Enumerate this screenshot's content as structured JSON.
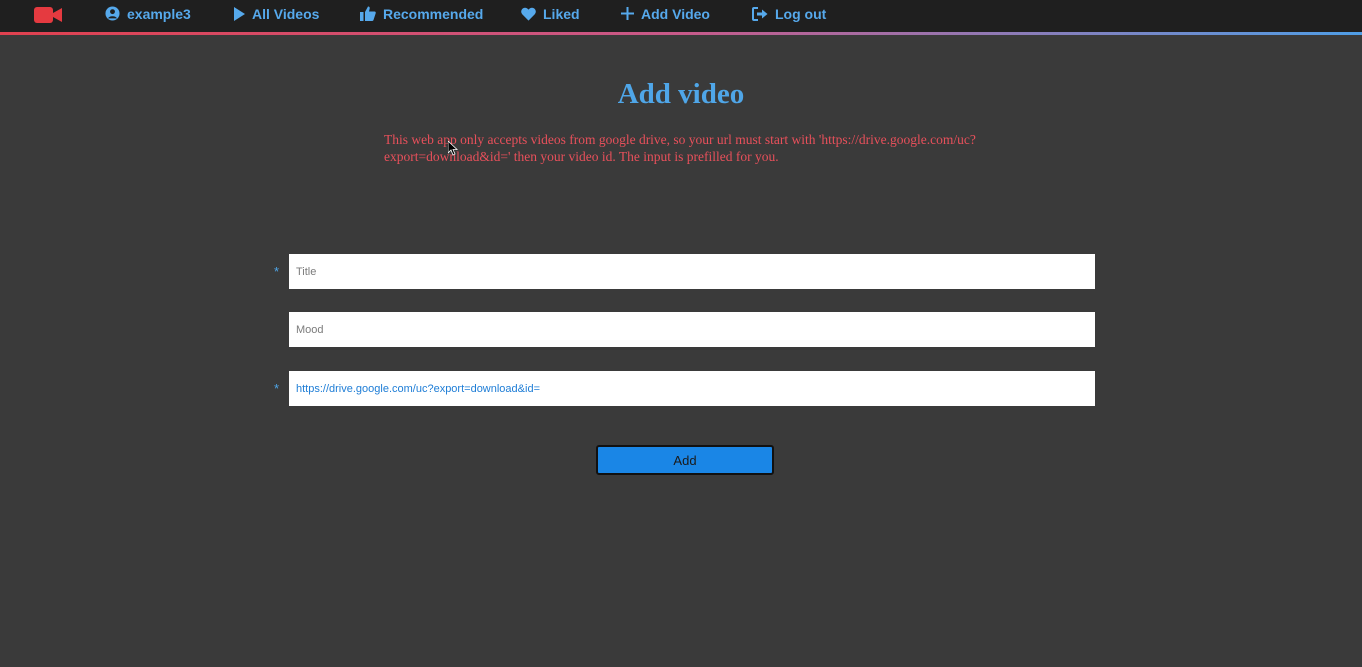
{
  "nav": {
    "logo_icon": "video-camera-icon",
    "items": [
      {
        "label": "example3",
        "icon": "user-circle-icon"
      },
      {
        "label": "All Videos",
        "icon": "play-icon"
      },
      {
        "label": "Recommended",
        "icon": "thumbs-up-icon"
      },
      {
        "label": "Liked",
        "icon": "heart-icon"
      },
      {
        "label": "Add Video",
        "icon": "plus-icon"
      },
      {
        "label": "Log out",
        "icon": "logout-icon"
      }
    ]
  },
  "main": {
    "title": "Add video",
    "notice": "This web app only accepts videos from google drive, so your url must start with 'https://drive.google.com/uc?export=download&id=' then your video id. The input is prefilled for you.",
    "required_mark": "*",
    "fields": {
      "title": {
        "placeholder": "Title",
        "value": ""
      },
      "mood": {
        "placeholder": "Mood",
        "value": ""
      },
      "url": {
        "placeholder": "",
        "value": "https://drive.google.com/uc?export=download&id="
      }
    },
    "submit_label": "Add"
  },
  "colors": {
    "background": "#3a3a3a",
    "topbar": "#1f1f1f",
    "accent_blue": "#4fa6e8",
    "warning_red": "#e8505b",
    "logo_red": "#e53a40",
    "button_blue": "#1a86e6"
  }
}
